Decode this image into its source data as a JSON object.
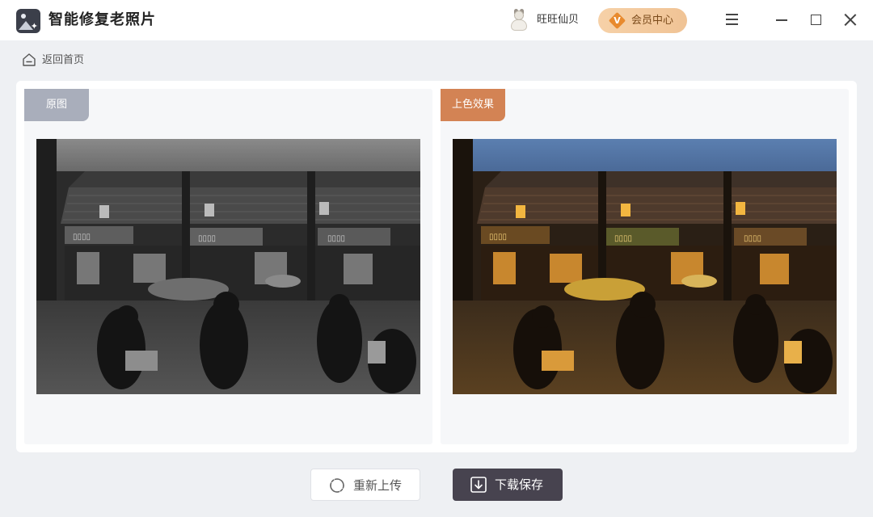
{
  "app": {
    "title": "智能修复老照片",
    "logo_icon": "photo-repair-logo-icon"
  },
  "header": {
    "username": "旺旺仙贝",
    "avatar_icon": "cat-avatar-icon",
    "vip_label": "会员中心",
    "vip_badge": "V",
    "window_controls": [
      "menu-icon",
      "minimize-icon",
      "maximize-icon",
      "close-icon"
    ]
  },
  "nav": {
    "back_label": "返回首页",
    "back_icon": "home-icon"
  },
  "panels": {
    "original": {
      "tag": "原图",
      "tag_color": "#a9aebb"
    },
    "colorized": {
      "tag": "上色效果",
      "tag_color": "#d38354"
    }
  },
  "actions": {
    "reupload_label": "重新上传",
    "reupload_icon": "refresh-icon",
    "download_label": "下载保存",
    "download_icon": "download-icon"
  },
  "colors": {
    "accent_dark": "#47434f",
    "vip_gradient": [
      "#f6d1a8",
      "#f0c395"
    ],
    "background": "#eef0f3"
  }
}
